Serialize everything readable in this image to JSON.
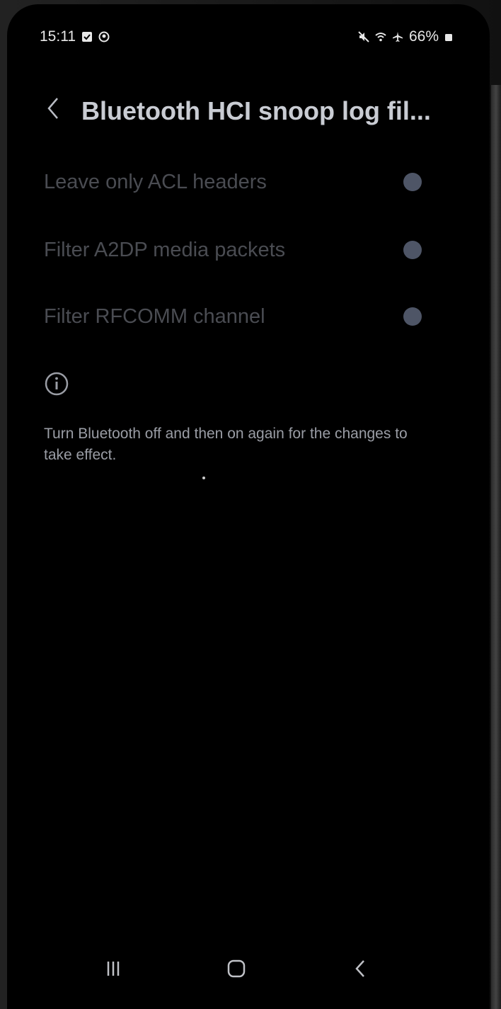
{
  "status_bar": {
    "time": "15:11",
    "battery": "66%",
    "icons": [
      "checklist-icon",
      "record-icon",
      "mute-icon",
      "wifi-icon",
      "airplane-icon",
      "battery-icon"
    ]
  },
  "header": {
    "title": "Bluetooth HCI snoop log fil..."
  },
  "options": [
    {
      "label": "Leave only ACL headers",
      "selected": false
    },
    {
      "label": "Filter A2DP media packets",
      "selected": false
    },
    {
      "label": "Filter RFCOMM channel",
      "selected": false
    }
  ],
  "info": {
    "text": "Turn Bluetooth off and then on again for the changes to take effect."
  },
  "navbar": {
    "items": [
      "recents-icon",
      "home-icon",
      "back-icon"
    ]
  },
  "colors": {
    "background": "#000000",
    "title": "#c9ccd3",
    "option_label": "#4a4c52",
    "radio": "#4e5566",
    "info_text": "#9a9da5"
  }
}
